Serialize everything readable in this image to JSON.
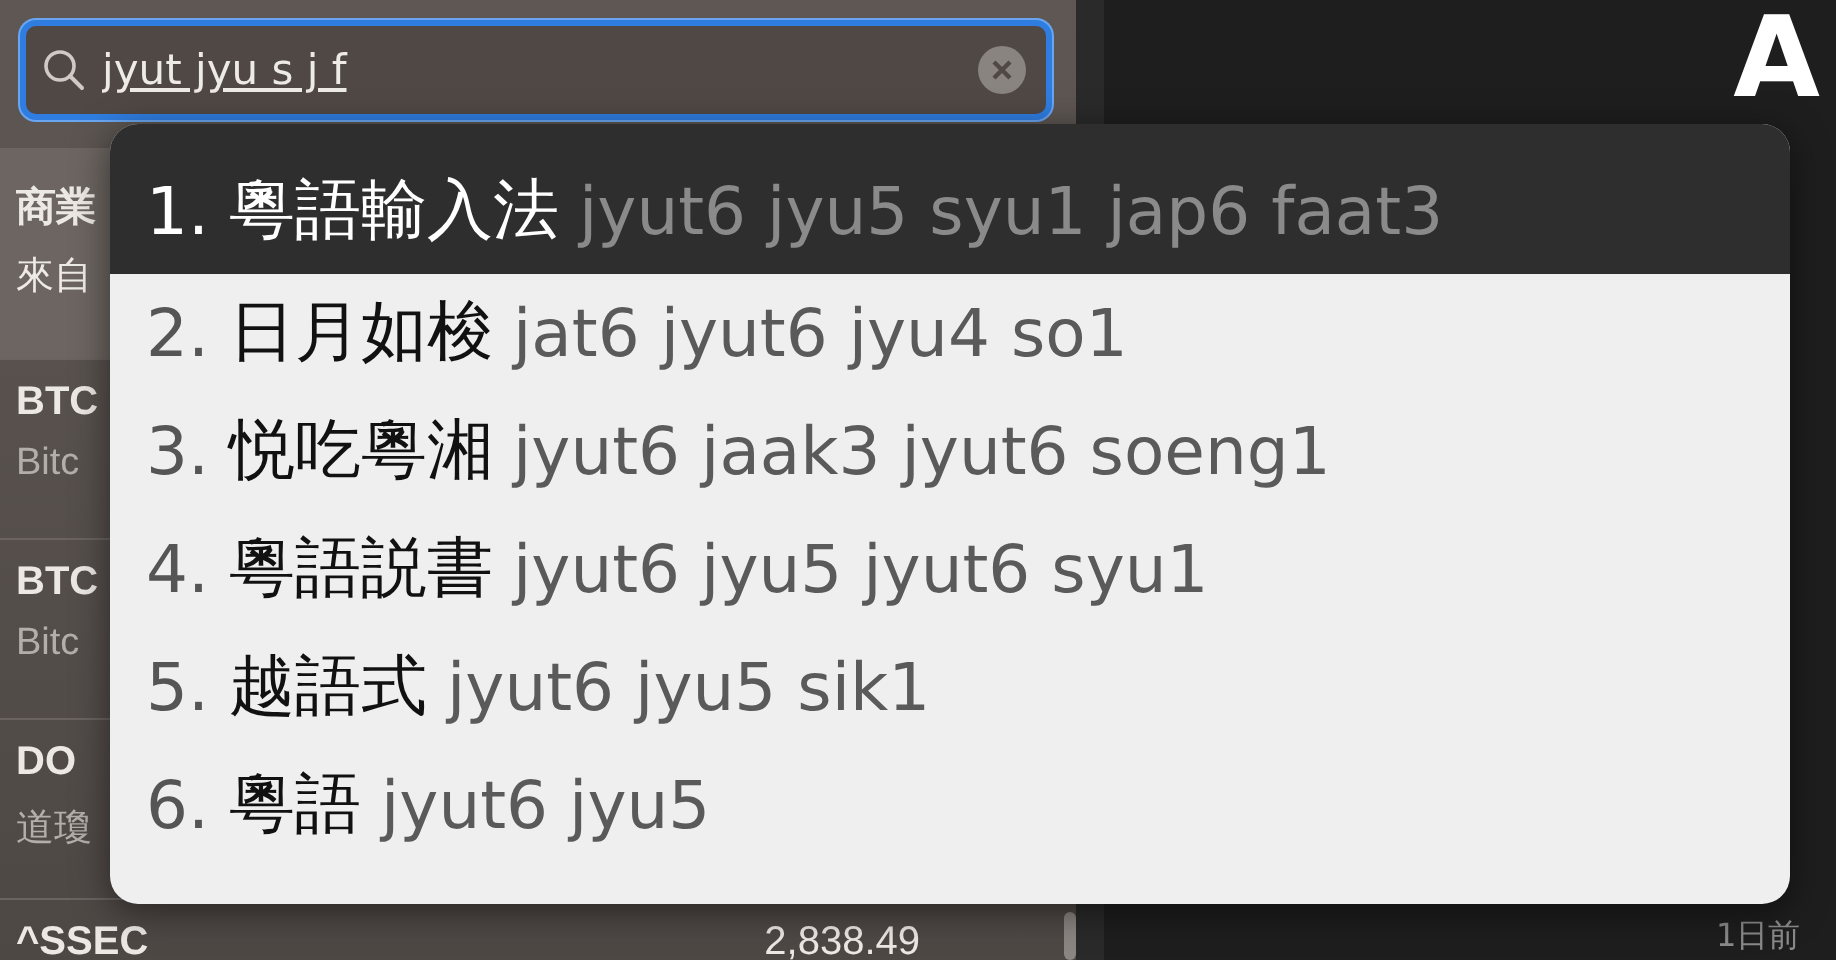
{
  "search": {
    "value": "jyut jyu s j f"
  },
  "sidebar_rows": [
    {
      "symbol": "商業",
      "name": "來自",
      "selected": true
    },
    {
      "symbol": "BTC",
      "name": "Bitc",
      "selected": false
    },
    {
      "symbol": "BTC",
      "name": "Bitc",
      "selected": false
    },
    {
      "symbol": "DO",
      "name": "道瓊",
      "selected": false
    },
    {
      "symbol": "^SSEC",
      "price": "2,838.49",
      "selected": false
    }
  ],
  "detail": {
    "heading": "A",
    "items": [
      {
        "kind": "label",
        "text": "1日前"
      }
    ]
  },
  "candidates": [
    {
      "index": "1.",
      "word": "粵語輸入法",
      "reading": "jyut6 jyu5 syu1 jap6 faat3",
      "selected": true
    },
    {
      "index": "2.",
      "word": "日月如梭",
      "reading": "jat6 jyut6 jyu4 so1",
      "selected": false
    },
    {
      "index": "3.",
      "word": "悦吃粵湘",
      "reading": "jyut6 jaak3 jyut6 soeng1",
      "selected": false
    },
    {
      "index": "4.",
      "word": "粵語説書",
      "reading": "jyut6 jyu5 jyut6 syu1",
      "selected": false
    },
    {
      "index": "5.",
      "word": "越語式",
      "reading": "jyut6 jyu5 sik1",
      "selected": false
    },
    {
      "index": "6.",
      "word": "粵語",
      "reading": "jyut6 jyu5",
      "selected": false
    }
  ]
}
